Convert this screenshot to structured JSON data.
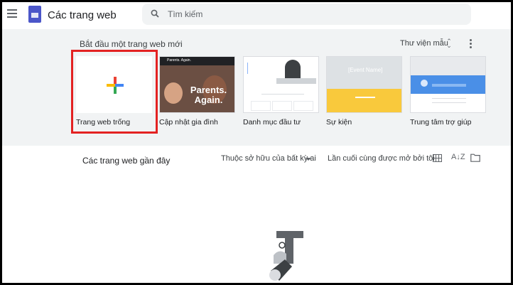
{
  "header": {
    "app_title": "Các trang web",
    "search_placeholder": "Tìm kiếm"
  },
  "templates": {
    "section_label": "Bắt đầu một trang web mới",
    "gallery_label": "Thư viện mẫu",
    "items": [
      {
        "label": "Trang web trống"
      },
      {
        "label": "Cập nhật gia đình",
        "thumb_text": "Parents. Again.",
        "thumb_header": "Parents. Again."
      },
      {
        "label": "Danh mục đầu tư"
      },
      {
        "label": "Sự kiện",
        "thumb_text": "[Event Name]"
      },
      {
        "label": "Trung tâm trợ giúp"
      }
    ]
  },
  "recent": {
    "title": "Các trang web gần đây",
    "owner_filter": "Thuộc sở hữu của bất kỳ ai",
    "sort_label": "Lần cuối cùng được mở bởi tôi"
  },
  "colors": {
    "accent_red": "#e32222",
    "plus_red": "#ea4335",
    "plus_yellow": "#fbbc04",
    "plus_green": "#34a853",
    "plus_blue": "#4285f4"
  }
}
